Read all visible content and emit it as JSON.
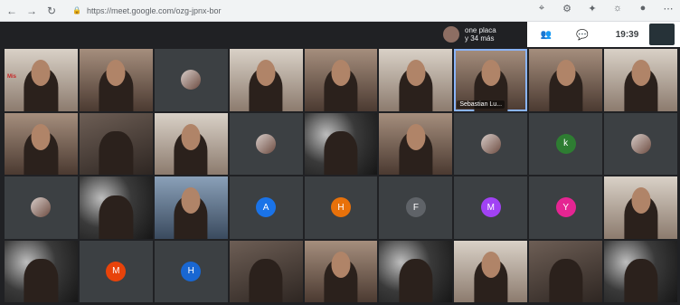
{
  "browser": {
    "url": "https://meet.google.com/ozg-jpnx-bor"
  },
  "meet": {
    "others_text_1": "one placa",
    "others_text_2": "y 34 más",
    "clock": "19:39"
  },
  "tiles": {
    "t1_title": "Mis",
    "t8_label": "Sebastian Lu..."
  },
  "avatars": {
    "k": {
      "letter": "k",
      "color": "#2e7d32"
    },
    "a": {
      "letter": "A",
      "color": "#1a73e8"
    },
    "h1": {
      "letter": "H",
      "color": "#e8710a"
    },
    "f": {
      "letter": "F",
      "color": "#5f6368"
    },
    "m1": {
      "letter": "M",
      "color": "#a142f4"
    },
    "y": {
      "letter": "Y",
      "color": "#e52592"
    },
    "m2": {
      "letter": "M",
      "color": "#e8430a"
    },
    "h2": {
      "letter": "H",
      "color": "#1967d2"
    }
  }
}
